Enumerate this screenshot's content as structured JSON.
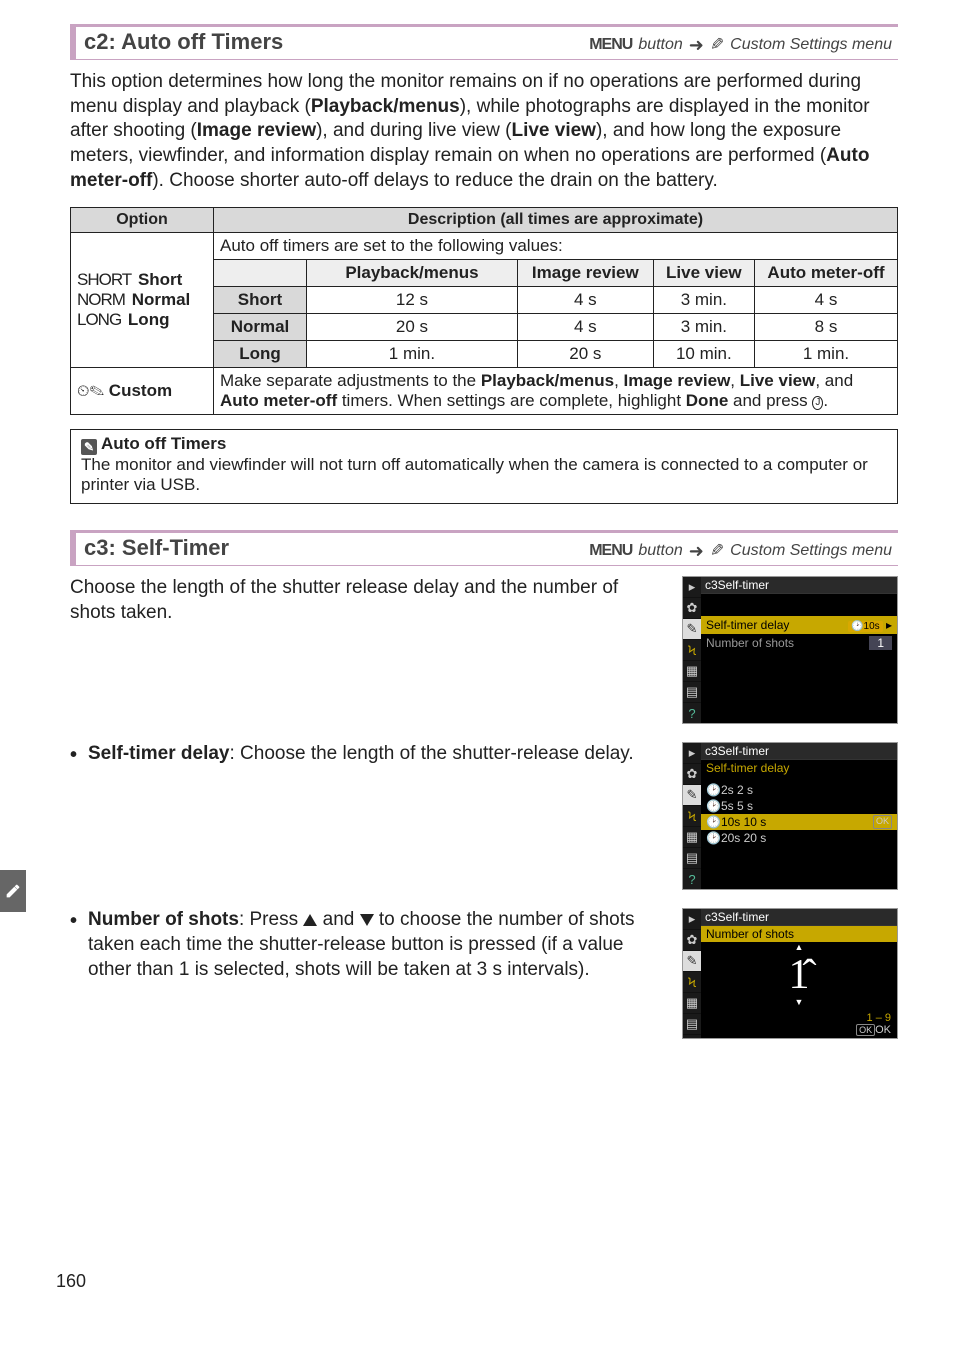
{
  "s1": {
    "title": "c2: Auto off Timers",
    "crumb_menu": "MENU",
    "crumb_button": "button",
    "crumb_target": "Custom Settings menu",
    "intro_pre": "This option determines how long the monitor remains on if no operations are performed during menu display and playback (",
    "pb": "Playback/menus",
    "intro_mid1": "), while photographs are displayed in the monitor after shooting (",
    "ir": "Image review",
    "intro_mid2": "), and during live view (",
    "lv": "Live view",
    "intro_mid3": "), and how long the exposure meters, viewfinder, and information display remain on when no operations are performed (",
    "amo": "Auto meter-off",
    "intro_end": ").  Choose shorter auto-off delays to reduce the drain on the battery.",
    "tbl": {
      "h_option": "Option",
      "h_desc": "Description (all times are approximate)",
      "values_intro": "Auto off timers are set to the following values:",
      "col_pb": "Playback/menus",
      "col_ir": "Image review",
      "col_lv": "Live view",
      "col_amo": "Auto meter-off",
      "row_short_pre": "SHORT",
      "row_short_b": "Short",
      "row_normal_pre": "NORM",
      "row_normal_b": "Normal",
      "row_long_pre": "LONG",
      "row_long_b": "Long",
      "cell_short_lbl": "Short",
      "cell_normal_lbl": "Normal",
      "cell_long_lbl": "Long",
      "r_s": {
        "pb": "12 s",
        "ir": "4 s",
        "lv": "3 min.",
        "amo": "4 s"
      },
      "r_n": {
        "pb": "20 s",
        "ir": "4 s",
        "lv": "3 min.",
        "amo": "8 s"
      },
      "r_l": {
        "pb": "1 min.",
        "ir": "20 s",
        "lv": "10 min.",
        "amo": "1 min."
      },
      "custom_icn": "⏲✎",
      "custom_lbl": "Custom",
      "custom_pre": "Make separate adjustments to the ",
      "custom_b1": "Playback/menus",
      "custom_c1": ", ",
      "custom_b2": "Image review",
      "custom_c2": ", ",
      "custom_b3": "Live view",
      "custom_c3": ", and ",
      "custom_b4": "Auto meter-off",
      "custom_mid": " timers.  When settings are complete, highlight ",
      "custom_b5": "Done",
      "custom_post": " and press ",
      "custom_ok": "J",
      "custom_period": "."
    },
    "note_title": "Auto off Timers",
    "note_body": "The monitor and viewfinder will not turn off automatically when the camera is connected to a computer or printer via USB."
  },
  "s2": {
    "title": "c3: Self-Timer",
    "crumb_menu": "MENU",
    "crumb_button": "button",
    "crumb_target": "Custom Settings menu",
    "intro": "Choose the length of the shutter release delay and the number of shots taken.",
    "b1_pre": "Self-timer delay",
    "b1_post": ": Choose the length of the shutter-release delay.",
    "b2_pre": "Number of shots",
    "b2_mid1": ": Press ",
    "b2_mid2": " and ",
    "b2_mid3": " to choose the number of shots taken each time the shutter-release button is pressed (if a value other than 1 is selected, shots will be taken at 3 s intervals).",
    "thumb1": {
      "title": "c3Self-timer",
      "row1": "Self-timer delay",
      "row1v": "🕑10s",
      "row2": "Number of shots",
      "row2v": "1"
    },
    "thumb2": {
      "title": "c3Self-timer",
      "sub": "Self-timer delay",
      "o1": "🕑2s  2 s",
      "o2": "🕑5s  5 s",
      "o3": "🕑10s 10 s",
      "o4": "🕑20s 20 s"
    },
    "thumb3": {
      "title": "c3Self-timer",
      "sub": "Number of shots",
      "big": "1̂",
      "range": "1 – 9",
      "ok": "OK"
    }
  },
  "pagenum": "160"
}
